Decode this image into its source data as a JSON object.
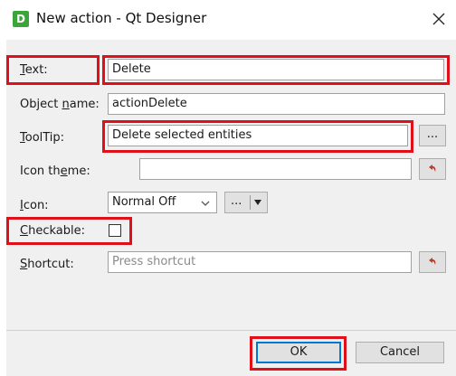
{
  "window": {
    "title": "New action - Qt Designer",
    "app_icon_letter": "D"
  },
  "form": {
    "text": {
      "label_pre": "",
      "label_mnemonic": "T",
      "label_post": "ext:",
      "value": "Delete"
    },
    "object_name": {
      "label_pre": "Object ",
      "label_mnemonic": "n",
      "label_post": "ame:",
      "value": "actionDelete"
    },
    "tooltip": {
      "label_pre": "",
      "label_mnemonic": "T",
      "label_post": "oolTip:",
      "value": "Delete selected entities",
      "button": "..."
    },
    "icon_theme": {
      "label_pre": "Icon th",
      "label_mnemonic": "e",
      "label_post": "me:",
      "value": ""
    },
    "icon": {
      "label_pre": "",
      "label_mnemonic": "I",
      "label_post": "con:",
      "mode": "Normal Off",
      "button": "..."
    },
    "checkable": {
      "label_pre": "",
      "label_mnemonic": "C",
      "label_post": "heckable:",
      "checked": false
    },
    "shortcut": {
      "label_pre": "",
      "label_mnemonic": "S",
      "label_post": "hortcut:",
      "placeholder": "Press shortcut"
    }
  },
  "buttons": {
    "ok": "OK",
    "cancel": "Cancel"
  },
  "colors": {
    "highlight": "#e0101b",
    "app_icon": "#3aa63a",
    "reset_icon": "#c0392b"
  },
  "icons": {
    "reset": "reset-arrow-icon",
    "close": "close-icon",
    "dropdown": "chevron-down-icon"
  }
}
